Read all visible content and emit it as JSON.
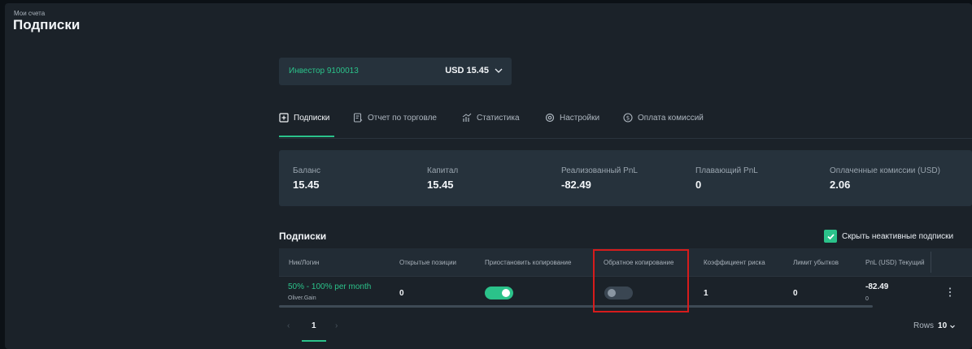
{
  "header": {
    "breadcrumb": "Мои счета",
    "title": "Подписки"
  },
  "account": {
    "name": "Инвестор 9100013",
    "balance": "USD 15.45"
  },
  "tabs": [
    {
      "label": "Подписки",
      "icon": "plus-square-icon",
      "active": true
    },
    {
      "label": "Отчет по торговле",
      "icon": "report-icon"
    },
    {
      "label": "Статистика",
      "icon": "chart-icon"
    },
    {
      "label": "Настройки",
      "icon": "gear-icon"
    },
    {
      "label": "Оплата комиссий",
      "icon": "dollar-circle-icon"
    }
  ],
  "stats": [
    {
      "label": "Баланс",
      "value": "15.45"
    },
    {
      "label": "Капитал",
      "value": "15.45"
    },
    {
      "label": "Реализованный PnL",
      "value": "-82.49"
    },
    {
      "label": "Плавающий PnL",
      "value": "0"
    },
    {
      "label": "Оплаченные комиссии (USD)",
      "value": "2.06"
    }
  ],
  "subscriptions": {
    "title": "Подписки",
    "hide_inactive_label": "Скрыть неактивные подписки",
    "hide_inactive_checked": true,
    "columns": [
      "Ник/Логин",
      "Открытые позиции",
      "Приостановить копирование",
      "Обратное копирование",
      "Коэффициент риска",
      "Лимит убытков",
      "PnL (USD) Текущий"
    ],
    "rows": [
      {
        "nick": "50% - 100% per month",
        "login": "Oliver.Gain",
        "open_positions": "0",
        "pause_copy": true,
        "reverse_copy": false,
        "risk_ratio": "1",
        "loss_limit": "0",
        "pnl": "-82.49",
        "pnl_sub": "0"
      }
    ]
  },
  "pagination": {
    "current_page": "1",
    "rows_label": "Rows",
    "rows_value": "10"
  },
  "colors": {
    "accent": "#2bc28a",
    "highlight": "#d61c1c",
    "background": "#0c1116",
    "panel": "#1b2229"
  }
}
